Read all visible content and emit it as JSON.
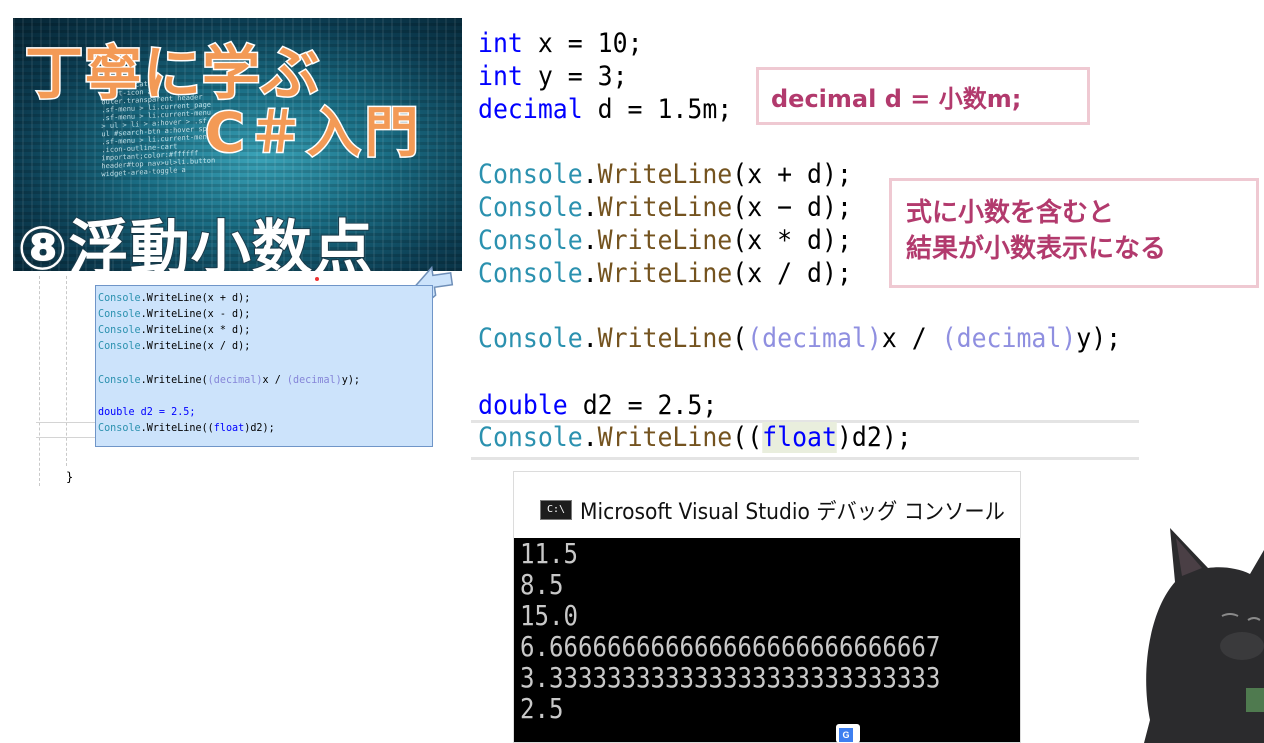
{
  "thumbnail": {
    "title_line1": "丁寧に学ぶ",
    "title_line2": "C＃入門",
    "episode": "⑧浮動小数点",
    "bg_code": "  .tb-indicator\n  .cart-icon a\n  outer.transparent header\n  .sf-menu > li.current_page\n  .sf-menu > li.current-menu\n  > ul > li > a:hover > .sf\n  ul #search-btn a:hover span\n  .sf-menu > li.current-menu\n  .icon-outline-cart\n  important;color:#ffffff\n  header#top nav>ul>li.button\n  widget-area-toggle a"
  },
  "small_editor": {
    "lines": [
      {
        "cls": "Console",
        "rest": ".WriteLine(x + d);"
      },
      {
        "cls": "Console",
        "rest": ".WriteLine(x - d);"
      },
      {
        "cls": "Console",
        "rest": ".WriteLine(x * d);"
      },
      {
        "cls": "Console",
        "rest": ".WriteLine(x / d);"
      }
    ],
    "cast_line": {
      "cls": "Console",
      "a": ".WriteLine(",
      "c1": "(decimal)",
      "b": "x / ",
      "c2": "(decimal)",
      "e": "y);"
    },
    "double_line": "double d2 = 2.5;",
    "float_line": {
      "cls": "Console",
      "a": ".WriteLine((",
      "kw": "float",
      "b": ")d2);"
    },
    "brace": "}"
  },
  "code": {
    "int_x": {
      "kw": "int",
      "rest": " x = 10;"
    },
    "int_y": {
      "kw": "int",
      "rest": " y = 3;"
    },
    "decimal_d": {
      "kw": "decimal",
      "rest": " d = 1.5m;"
    },
    "writelines": [
      {
        "cls": "Console",
        "dot": ".",
        "m": "WriteLine",
        "rest": "(x + d);"
      },
      {
        "cls": "Console",
        "dot": ".",
        "m": "WriteLine",
        "rest": "(x − d);"
      },
      {
        "cls": "Console",
        "dot": ".",
        "m": "WriteLine",
        "rest": "(x * d);"
      },
      {
        "cls": "Console",
        "dot": ".",
        "m": "WriteLine",
        "rest": "(x / d);"
      }
    ],
    "cast_line": {
      "cls": "Console",
      "dot": ".",
      "m": "WriteLine",
      "p1": "(",
      "c1": "(decimal)",
      "x": "x / ",
      "c2": "(decimal)",
      "y": "y);"
    },
    "double_line": {
      "kw": "double",
      "rest": " d2 = 2.5;"
    },
    "float_line": {
      "cls": "Console",
      "dot": ".",
      "m": "WriteLine",
      "p1": "((",
      "kw": "float",
      "rest": ")d2);"
    }
  },
  "notes": {
    "note1": "decimal d = 小数m;",
    "note2_line1": "式に小数を含むと",
    "note2_line2": "結果が小数表示になる"
  },
  "console": {
    "icon_text": "C:\\",
    "title": "Microsoft Visual Studio デバッグ コンソール",
    "output": [
      "11.5",
      "8.5",
      "15.0",
      "6.666666666666666666666666667",
      "3.333333333333333333333333333",
      "2.5"
    ]
  },
  "colors": {
    "keyword": "#0000ff",
    "class": "#2b91af",
    "method": "#74531f",
    "cast": "#8f8fe0",
    "note_text": "#b23a6d",
    "note_border": "#efc9d2"
  }
}
